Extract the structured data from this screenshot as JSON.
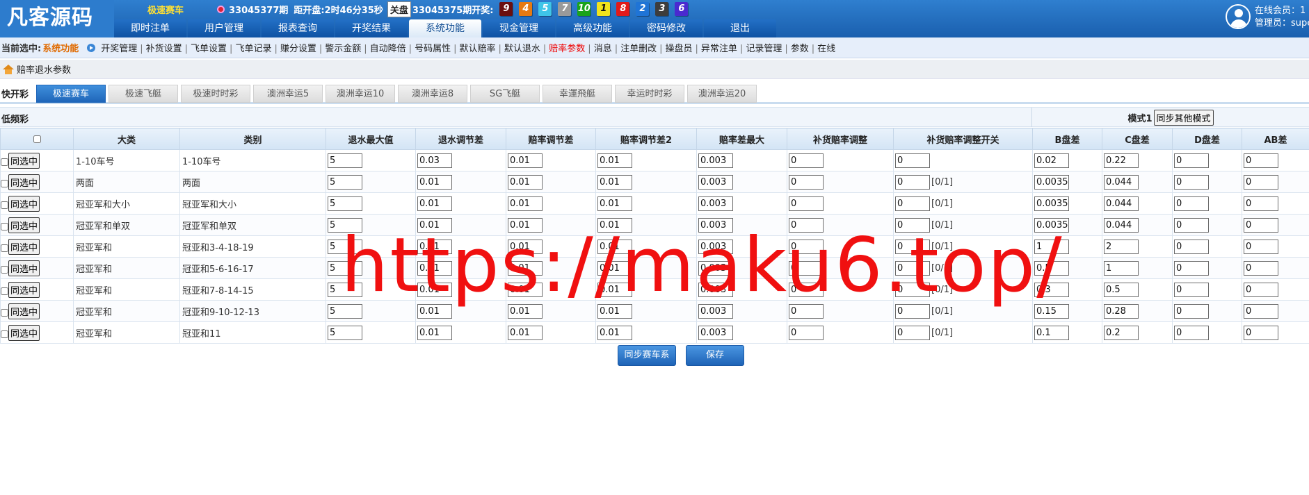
{
  "logo": "凡客源码",
  "infobar": {
    "game": "极速赛车",
    "current_period": "33045377期",
    "countdown": "距开盘:2时46分35秒",
    "close_badge": "关盘",
    "last_period": "33045375期开奖:",
    "balls": [
      {
        "num": "9",
        "color": "#6b0f0f"
      },
      {
        "num": "4",
        "color": "#e67a12"
      },
      {
        "num": "5",
        "color": "#3fc5e8"
      },
      {
        "num": "7",
        "color": "#9a9a9a"
      },
      {
        "num": "10",
        "color": "#1aa31a"
      },
      {
        "num": "1",
        "color": "#f0e41c"
      },
      {
        "num": "8",
        "color": "#e21a1a"
      },
      {
        "num": "2",
        "color": "#1f74d6"
      },
      {
        "num": "3",
        "color": "#3d3d3d"
      },
      {
        "num": "6",
        "color": "#4a2ad0"
      }
    ]
  },
  "nav": {
    "tabs": [
      "即时注单",
      "用户管理",
      "报表查询",
      "开奖结果",
      "系统功能",
      "现金管理",
      "高级功能",
      "密码修改",
      "退出"
    ],
    "active": 4
  },
  "user": {
    "online": "在线会员：1",
    "admin": "管理员：super"
  },
  "submenu": {
    "current_label": "当前选中:",
    "current_value": "系统功能",
    "items": [
      "开奖管理",
      "补货设置",
      "飞单设置",
      "飞单记录",
      "赚分设置",
      "警示金额",
      "自动降倍",
      "号码属性",
      "默认赔率",
      "默认退水",
      "赔率参数",
      "消息",
      "注单删改",
      "操盘员",
      "异常注单",
      "记录管理",
      "参数",
      "在线"
    ],
    "active": 10
  },
  "breadcrumb": "赔率退水参数",
  "lottery": {
    "fast_label": "快开彩",
    "slow_label": "低频彩",
    "tabs": [
      "极速赛车",
      "极速飞艇",
      "极速时时彩",
      "澳洲幸运5",
      "澳洲幸运10",
      "澳洲幸运8",
      "SG飞艇",
      "幸運飛艇",
      "幸运时时彩",
      "澳洲幸运20"
    ],
    "active": 0
  },
  "mode": {
    "label": "模式1",
    "button": "同步其他模式"
  },
  "table": {
    "headers": [
      "",
      "大类",
      "类别",
      "退水最大值",
      "退水调节差",
      "赔率调节差",
      "赔率调节差2",
      "赔率差最大",
      "补货赔率调整",
      "补货赔率调整开关",
      "B盘差",
      "C盘差",
      "D盘差",
      "AB差"
    ],
    "sync_label": "同选中",
    "flag_label": "[0/1]",
    "rows": [
      {
        "cat": "1-10车号",
        "sub": "1-10车号",
        "v": [
          "5",
          "0.03",
          "0.01",
          "0.01",
          "0.003",
          "0",
          "0",
          "0.02",
          "0.22",
          "0",
          "0"
        ],
        "flag": false
      },
      {
        "cat": "两面",
        "sub": "两面",
        "v": [
          "5",
          "0.01",
          "0.01",
          "0.01",
          "0.003",
          "0",
          "0",
          "0.0035",
          "0.044",
          "0",
          "0"
        ],
        "flag": true
      },
      {
        "cat": "冠亚军和大小",
        "sub": "冠亚军和大小",
        "v": [
          "5",
          "0.01",
          "0.01",
          "0.01",
          "0.003",
          "0",
          "0",
          "0.0035",
          "0.044",
          "0",
          "0"
        ],
        "flag": true
      },
      {
        "cat": "冠亚军和单双",
        "sub": "冠亚军和单双",
        "v": [
          "5",
          "0.01",
          "0.01",
          "0.01",
          "0.003",
          "0",
          "0",
          "0.0035",
          "0.044",
          "0",
          "0"
        ],
        "flag": true
      },
      {
        "cat": "冠亚军和",
        "sub": "冠亚和3-4-18-19",
        "v": [
          "5",
          "0.01",
          "0.01",
          "0.01",
          "0.003",
          "0",
          "0",
          "1",
          "2",
          "0",
          "0"
        ],
        "flag": true
      },
      {
        "cat": "冠亚军和",
        "sub": "冠亚和5-6-16-17",
        "v": [
          "5",
          "0.01",
          "0.01",
          "0.01",
          "0.003",
          "0",
          "0",
          "0.5",
          "1",
          "0",
          "0"
        ],
        "flag": true
      },
      {
        "cat": "冠亚军和",
        "sub": "冠亚和7-8-14-15",
        "v": [
          "5",
          "0.01",
          "0.01",
          "0.01",
          "0.003",
          "0",
          "0",
          "0.3",
          "0.5",
          "0",
          "0"
        ],
        "flag": true
      },
      {
        "cat": "冠亚军和",
        "sub": "冠亚和9-10-12-13",
        "v": [
          "5",
          "0.01",
          "0.01",
          "0.01",
          "0.003",
          "0",
          "0",
          "0.15",
          "0.28",
          "0",
          "0"
        ],
        "flag": true
      },
      {
        "cat": "冠亚军和",
        "sub": "冠亚和11",
        "v": [
          "5",
          "0.01",
          "0.01",
          "0.01",
          "0.003",
          "0",
          "0",
          "0.1",
          "0.2",
          "0",
          "0"
        ],
        "flag": true
      }
    ]
  },
  "actions": {
    "sync_series": "同步赛车系列",
    "save": "保存"
  },
  "watermark": "https://maku6.top/"
}
